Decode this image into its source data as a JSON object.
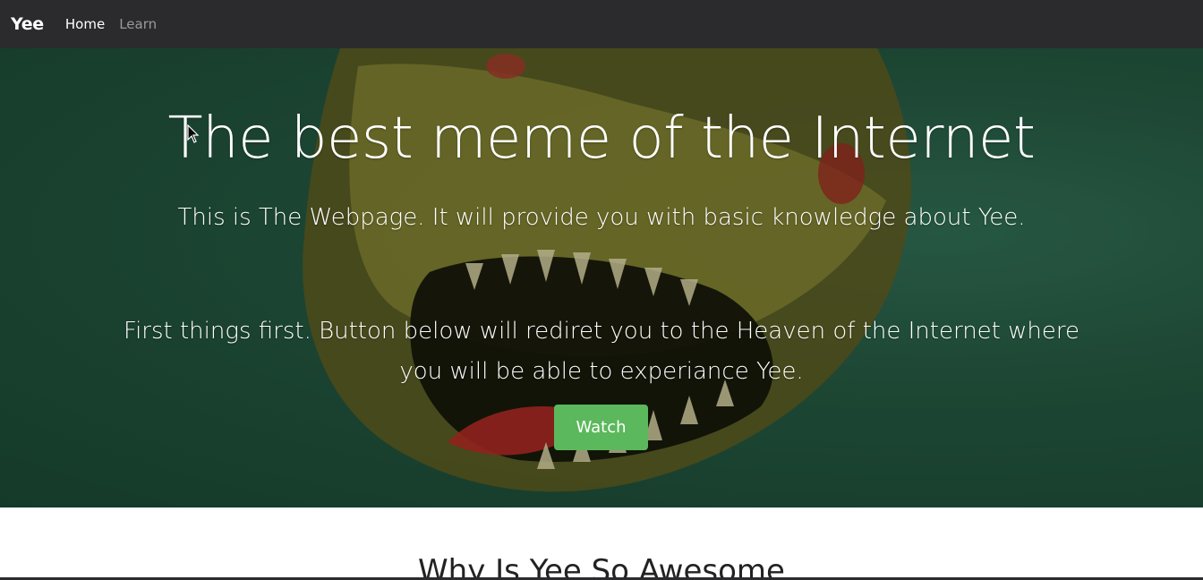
{
  "navbar": {
    "brand": "Yee",
    "links": [
      {
        "label": "Home",
        "active": true
      },
      {
        "label": "Learn",
        "active": false
      }
    ]
  },
  "hero": {
    "title": "The best meme of the Internet",
    "subtitle": "This is The Webpage. It will provide you with basic knowledge about Yee.",
    "body": "First things first. Button below will rediret you to the Heaven of the Internet where you will be able to experiance Yee.",
    "button_label": "Watch"
  },
  "section": {
    "title": "Why Is Yee So Awesome"
  },
  "colors": {
    "navbar_bg": "#2b2b2d",
    "button_bg": "#5cb85c",
    "hero_bg": "#24563f"
  }
}
